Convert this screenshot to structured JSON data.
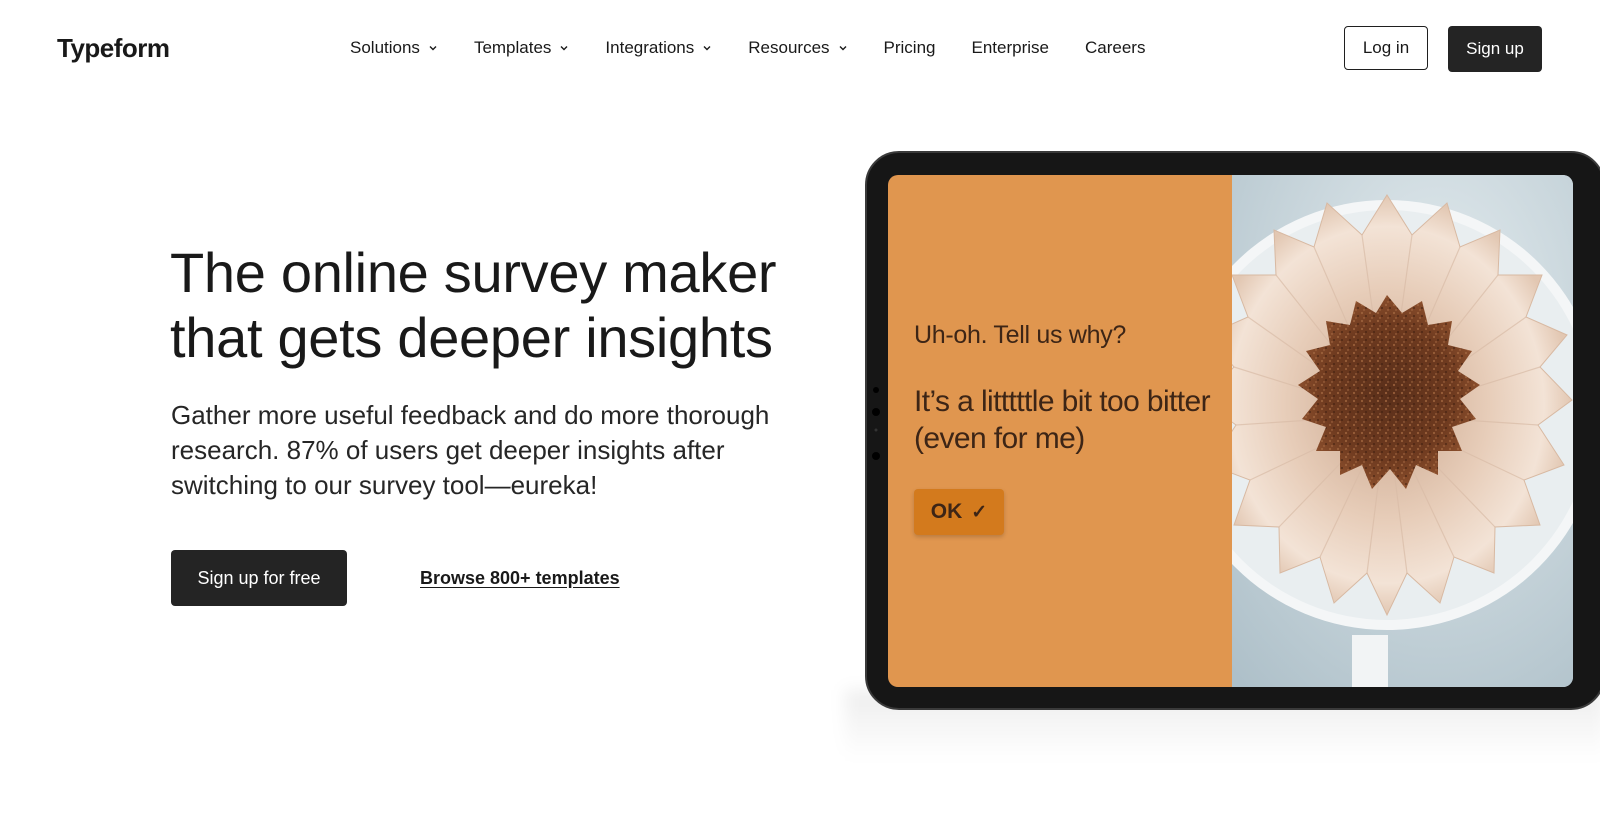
{
  "header": {
    "logo": "Typeform",
    "nav": [
      {
        "label": "Solutions",
        "dropdown": true
      },
      {
        "label": "Templates",
        "dropdown": true
      },
      {
        "label": "Integrations",
        "dropdown": true
      },
      {
        "label": "Resources",
        "dropdown": true
      },
      {
        "label": "Pricing",
        "dropdown": false
      },
      {
        "label": "Enterprise",
        "dropdown": false
      },
      {
        "label": "Careers",
        "dropdown": false
      }
    ],
    "login_label": "Log in",
    "signup_label": "Sign up"
  },
  "hero": {
    "title": "The online survey maker that gets deeper insights",
    "subtitle": "Gather more useful feedback and do more thorough research. 87% of users get deeper insights after switching to our survey tool—eureka!",
    "cta_label": "Sign up for free",
    "browse_link": "Browse 800+ templates"
  },
  "device_preview": {
    "question": "Uh-oh. Tell us why?",
    "answer": "It’s a litttttle bit too bitter (even for me)",
    "ok_label": "OK",
    "ok_icon": "check-icon",
    "image": "coffee-filter-with-grounds",
    "colors": {
      "panel": "#e0964f",
      "button": "#d37a1d",
      "text": "#3d2516"
    }
  },
  "colors": {
    "primary_button": "#242424",
    "text": "#191919",
    "background": "#ffffff"
  }
}
